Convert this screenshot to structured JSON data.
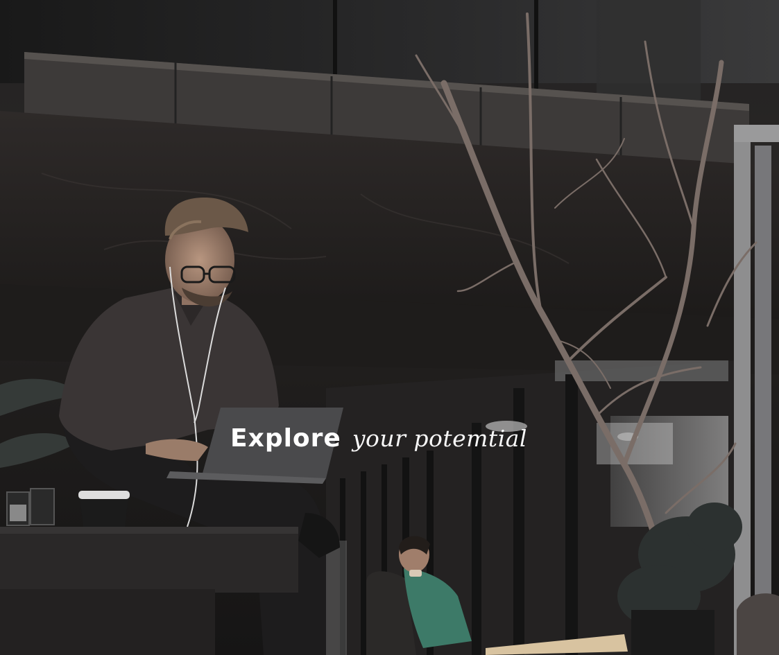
{
  "hero": {
    "headline_bold": "Explore",
    "headline_script": "your potemtial"
  },
  "scene": {
    "description_icon": "photo-icon",
    "colors": {
      "wall": "#2c2827",
      "balcony": "#3b3938",
      "glass": "#1f1f20",
      "shirt": "#3a3535",
      "skin": "#a98a78",
      "hair": "#6b5848",
      "laptop": "#4a4a4c",
      "tree": "#6c5f5a",
      "accent_green": "#3d7a68",
      "text": "#ffffff"
    }
  }
}
